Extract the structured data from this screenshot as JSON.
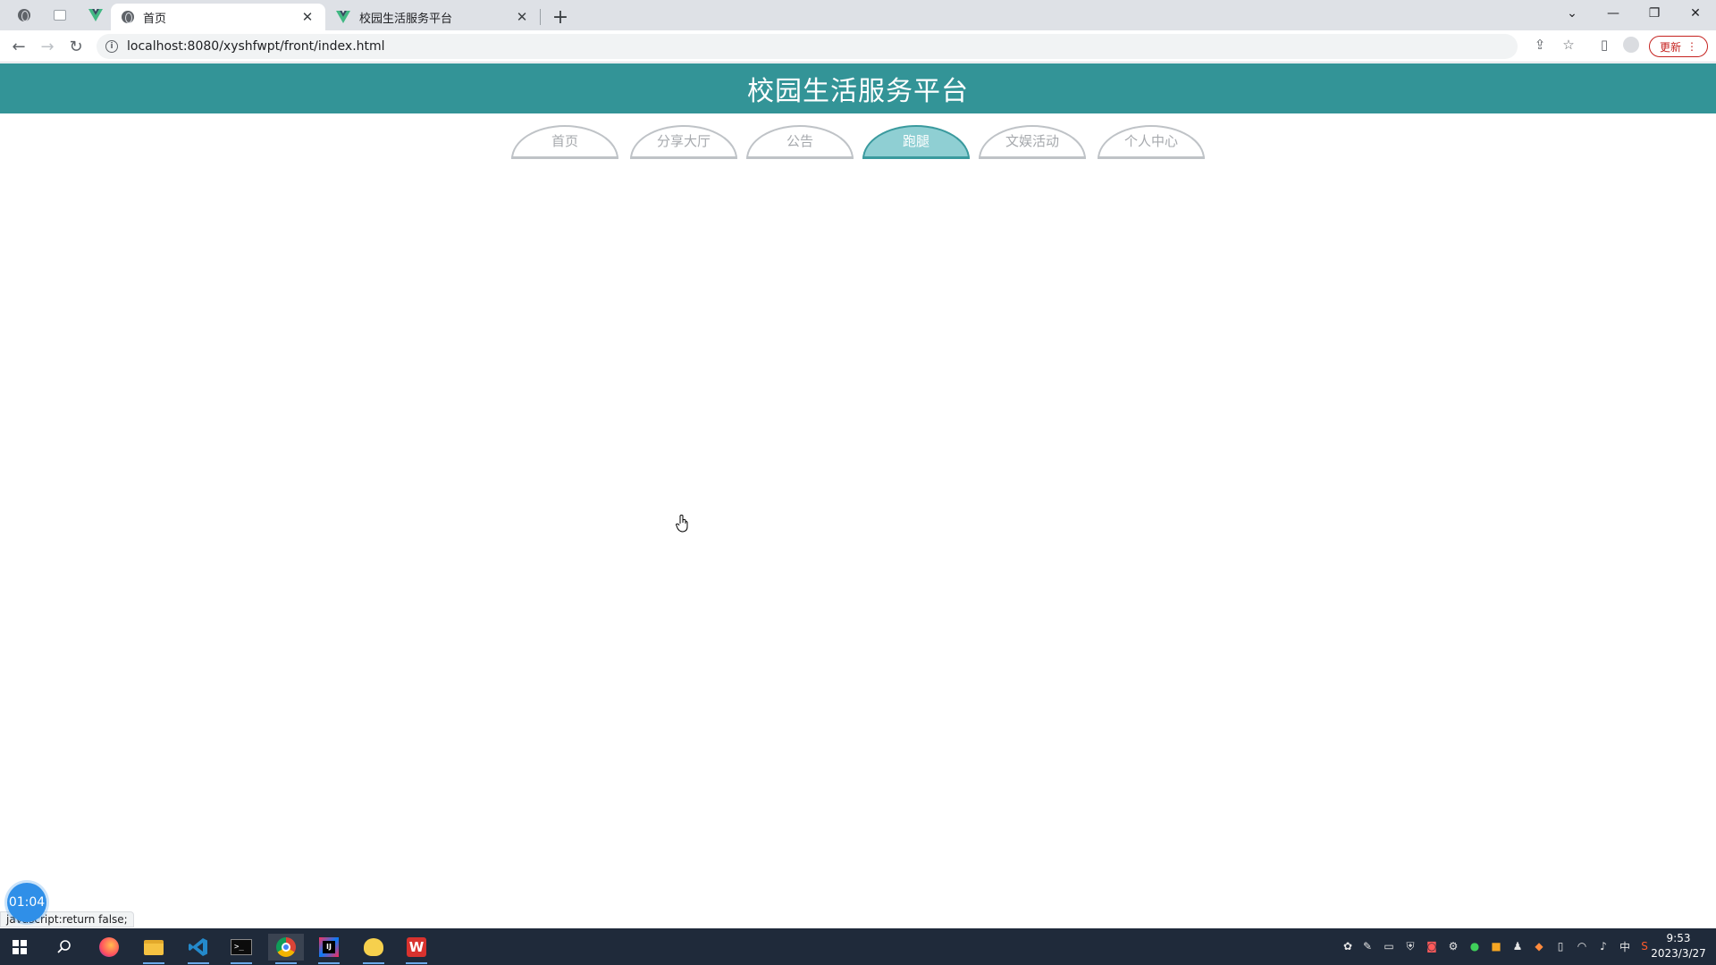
{
  "browser": {
    "tabs": [
      {
        "title": "首页",
        "active": true,
        "icon": "globe-icon"
      },
      {
        "title": "校园生活服务平台",
        "active": false,
        "icon": "vue-logo-icon"
      }
    ],
    "new_tab_label": "+",
    "address": {
      "url": "localhost:8080/xyshfwpt/front/index.html"
    },
    "update_label": "更新"
  },
  "site": {
    "title": "校园生活服务平台",
    "nav": [
      {
        "label": "首页",
        "active": false
      },
      {
        "label": "分享大厅",
        "active": false
      },
      {
        "label": "公告",
        "active": false
      },
      {
        "label": "跑腿",
        "active": true
      },
      {
        "label": "文娱活动",
        "active": false
      },
      {
        "label": "个人中心",
        "active": false
      }
    ]
  },
  "overlay": {
    "timer": "01:04",
    "status_text": "javascript:return false;"
  },
  "taskbar": {
    "clock_time": "9:53",
    "clock_date": "2023/3/27",
    "ime_label": "中"
  },
  "colors": {
    "header_bg": "#339497",
    "nav_active_bg": "#8fcfd3",
    "nav_active_border": "#3a9a9e",
    "taskbar_bg": "#1f2a3a"
  }
}
